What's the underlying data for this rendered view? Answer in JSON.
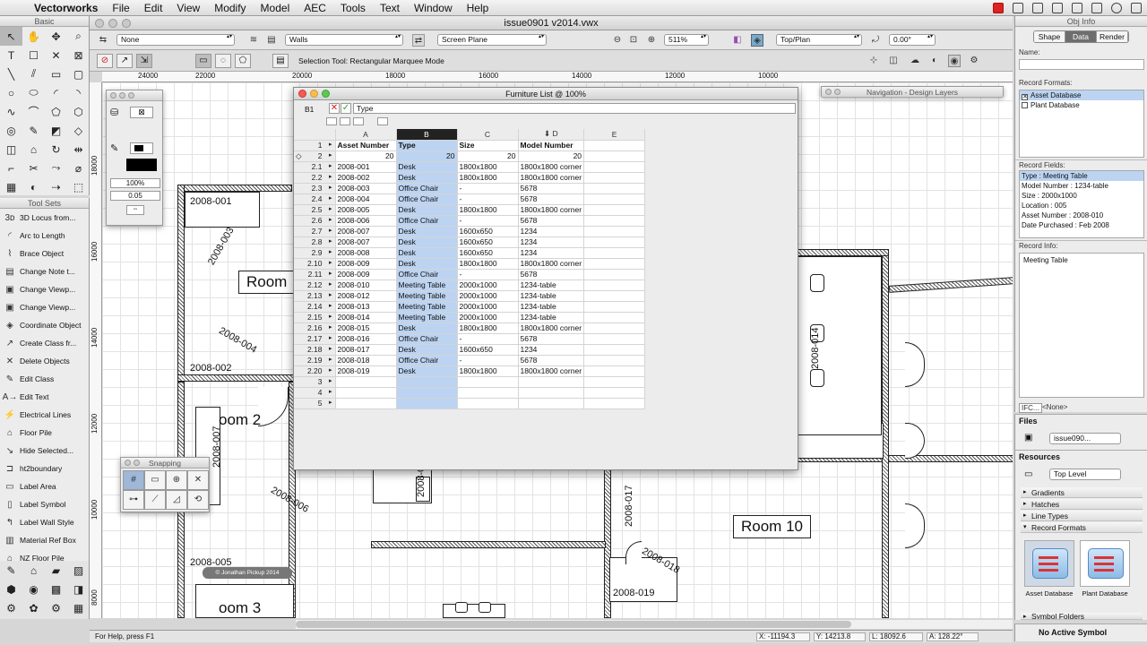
{
  "menubar": {
    "app": "Vectorworks",
    "items": [
      "File",
      "Edit",
      "View",
      "Modify",
      "Model",
      "AEC",
      "Tools",
      "Text",
      "Window",
      "Help"
    ]
  },
  "window": {
    "title": "issue0901 v2014.vwx"
  },
  "basic_palette": {
    "title": "Basic"
  },
  "viewbar": {
    "class": "None",
    "layer": "Walls",
    "plane": "Screen Plane",
    "zoom": "511%",
    "view": "Top/Plan",
    "rotation": "0.00°"
  },
  "modebar": {
    "hint": "Selection Tool: Rectangular Marquee Mode"
  },
  "ruler": {
    "h": [
      "24000",
      "22000",
      "20000",
      "18000",
      "16000",
      "14000",
      "12000",
      "10000"
    ],
    "v": [
      "18000",
      "16000",
      "14000",
      "12000",
      "10000",
      "8000"
    ]
  },
  "toolsets": {
    "title": "Tool Sets",
    "items": [
      "3D Locus from...",
      "Arc to Length",
      "Brace Object",
      "Change Note t...",
      "Change Viewp...",
      "Change Viewp...",
      "Coordinate Object",
      "Create Class fr...",
      "Delete Objects",
      "Edit Class",
      "Edit Text",
      "Electrical Lines",
      "Floor Pile",
      "Hide Selected...",
      "ht2boundary",
      "Label Area",
      "Label Symbol",
      "Label Wall Style",
      "Material Ref Box",
      "NZ Floor Pile"
    ]
  },
  "attributes": {
    "opacity": "100%",
    "line_weight": "0.05"
  },
  "worksheet": {
    "title": "Furniture List @ 100%",
    "cell_ref": "B1",
    "formula": "Type",
    "columns": [
      "A",
      "B",
      "C",
      "D",
      "E"
    ],
    "header_row": [
      "Asset Number",
      "Type",
      "Size",
      "Model Number",
      ""
    ],
    "count_row": [
      "20",
      "20",
      "20",
      "20"
    ],
    "rows": [
      {
        "n": "2.1",
        "a": "2008-001",
        "b": "Desk",
        "c": "1800x1800",
        "d": "1800x1800 corner"
      },
      {
        "n": "2.2",
        "a": "2008-002",
        "b": "Desk",
        "c": "1800x1800",
        "d": "1800x1800 corner"
      },
      {
        "n": "2.3",
        "a": "2008-003",
        "b": "Office Chair",
        "c": "-",
        "d": "5678"
      },
      {
        "n": "2.4",
        "a": "2008-004",
        "b": "Office Chair",
        "c": "-",
        "d": "5678"
      },
      {
        "n": "2.5",
        "a": "2008-005",
        "b": "Desk",
        "c": "1800x1800",
        "d": "1800x1800 corner"
      },
      {
        "n": "2.6",
        "a": "2008-006",
        "b": "Office Chair",
        "c": "-",
        "d": "5678"
      },
      {
        "n": "2.7",
        "a": "2008-007",
        "b": "Desk",
        "c": "1600x650",
        "d": "1234"
      },
      {
        "n": "2.8",
        "a": "2008-007",
        "b": "Desk",
        "c": "1600x650",
        "d": "1234"
      },
      {
        "n": "2.9",
        "a": "2008-008",
        "b": "Desk",
        "c": "1600x650",
        "d": "1234"
      },
      {
        "n": "2.10",
        "a": "2008-009",
        "b": "Desk",
        "c": "1800x1800",
        "d": "1800x1800 corner"
      },
      {
        "n": "2.11",
        "a": "2008-009",
        "b": "Office Chair",
        "c": "-",
        "d": "5678"
      },
      {
        "n": "2.12",
        "a": "2008-010",
        "b": "Meeting Table",
        "c": "2000x1000",
        "d": "1234-table"
      },
      {
        "n": "2.13",
        "a": "2008-012",
        "b": "Meeting Table",
        "c": "2000x1000",
        "d": "1234-table"
      },
      {
        "n": "2.14",
        "a": "2008-013",
        "b": "Meeting Table",
        "c": "2000x1000",
        "d": "1234-table"
      },
      {
        "n": "2.15",
        "a": "2008-014",
        "b": "Meeting Table",
        "c": "2000x1000",
        "d": "1234-table"
      },
      {
        "n": "2.16",
        "a": "2008-015",
        "b": "Desk",
        "c": "1800x1800",
        "d": "1800x1800 corner"
      },
      {
        "n": "2.17",
        "a": "2008-016",
        "b": "Office Chair",
        "c": "-",
        "d": "5678"
      },
      {
        "n": "2.18",
        "a": "2008-017",
        "b": "Desk",
        "c": "1600x650",
        "d": "1234"
      },
      {
        "n": "2.19",
        "a": "2008-018",
        "b": "Office Chair",
        "c": "-",
        "d": "5678"
      },
      {
        "n": "2.20",
        "a": "2008-019",
        "b": "Desk",
        "c": "1800x1800",
        "d": "1800x1800 corner"
      }
    ],
    "empty_rows": [
      "3",
      "4",
      "5"
    ],
    "row_numbers": [
      "1",
      "2"
    ]
  },
  "navigation": {
    "title": "Navigation - Design Layers"
  },
  "snapping": {
    "title": "Snapping"
  },
  "drawing": {
    "rooms": [
      "Room",
      "oom 2",
      "Room 10",
      "oom 3"
    ],
    "labels": [
      "2008-001",
      "2008-003",
      "2008-004",
      "2008-002",
      "2008-007",
      "2008-006",
      "2008-005",
      "2008-014",
      "2008-017",
      "2008-018",
      "2008-019",
      "2008-0"
    ],
    "copyright": "© Jonathan Pickup 2014"
  },
  "statusbar": {
    "help": "For Help, press F1",
    "x": "X: -11194.3",
    "y": "Y: 14213.8",
    "l": "L: 18092.6",
    "a": "A: 128.22°"
  },
  "objinfo": {
    "title": "Obj Info",
    "tabs": [
      "Shape",
      "Data",
      "Render"
    ],
    "name_label": "Name:",
    "record_formats_label": "Record Formats:",
    "record_formats": [
      {
        "label": "Asset Database",
        "checked": true
      },
      {
        "label": "Plant Database",
        "checked": false
      }
    ],
    "record_fields_label": "Record Fields:",
    "record_fields": [
      "Type : Meeting Table",
      "Model Number : 1234-table",
      "Size : 2000x1000",
      "Location : 005",
      "Asset Number : 2008-010",
      "Date Purchased : Feb 2008"
    ],
    "record_info_label": "Record Info:",
    "record_info": "Meeting Table",
    "ifc": "IFC...",
    "ifc_value": "<None>"
  },
  "files": {
    "title": "Files",
    "current": "issue090..."
  },
  "resources": {
    "title": "Resources",
    "scope": "Top Level",
    "categories": [
      "Gradients",
      "Hatches",
      "Line Types",
      "Record Formats"
    ],
    "thumbs": [
      {
        "label": "Asset Database"
      },
      {
        "label": "Plant Database"
      }
    ],
    "folder_cat": "Symbol Folders"
  },
  "active_symbol": "No Active Symbol",
  "colors": {
    "selection_blue": "#bcd4f2",
    "header_black": "#222222"
  }
}
